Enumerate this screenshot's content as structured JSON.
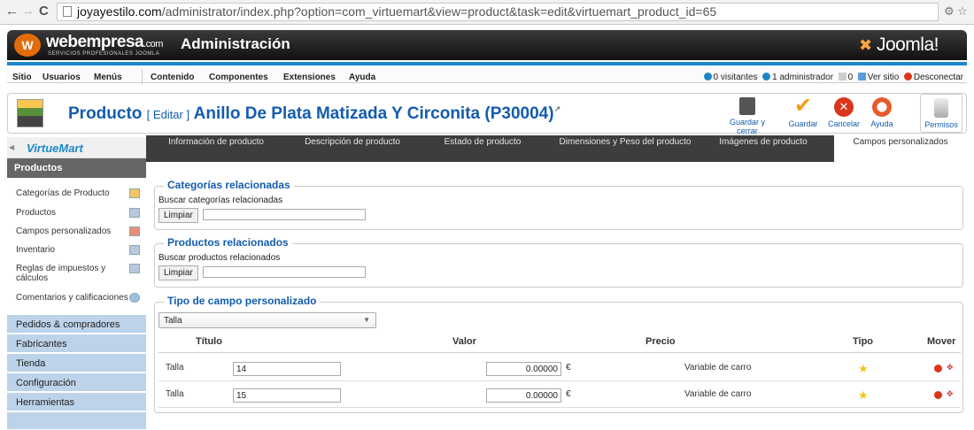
{
  "browser": {
    "url_host": "joyayestilo.com",
    "url_path": "/administrator/index.php?option=com_virtuemart&view=product&task=edit&virtuemart_product_id=65",
    "back": "←",
    "forward": "→",
    "reload": "C"
  },
  "header": {
    "logo_text": "webempresa",
    "logo_suffix": ".com",
    "logo_sub": "SERVICIOS PROFESIONALES JOOMLA",
    "admin_title": "Administración",
    "joomla": "Joomla!"
  },
  "menu": {
    "items": [
      "Sitio",
      "Usuarios",
      "Menús",
      "Contenido",
      "Componentes",
      "Extensiones",
      "Ayuda"
    ],
    "visitors": "0 visitantes",
    "admins": "1 administrador",
    "messages": "0",
    "view_site": "Ver sitio",
    "logout": "Desconectar"
  },
  "toolbar": {
    "title": "Producto",
    "mode": "[ Editar ]",
    "product": "Anillo De Plata Matizada Y Circonita (P30004)",
    "buttons": [
      "Guardar y cerrar",
      "Guardar",
      "Cancelar",
      "Ayuda",
      "Permisos"
    ]
  },
  "sidebar": {
    "brand": "VirtueMart",
    "section": "Productos",
    "items": [
      "Categorías de Producto",
      "Productos",
      "Campos personalizados",
      "Inventario",
      "Reglas de impuestos y cálculos",
      "Comentarios y calificaciones"
    ],
    "categories": [
      "Pedidos & compradores",
      "Fabricantes",
      "Tienda",
      "Configuración",
      "Herramientas"
    ]
  },
  "tabs": [
    "Información de producto",
    "Descripción de producto",
    "Estado de producto",
    "Dimensiones y Peso del producto",
    "Imágenes de producto",
    "Campos personalizados"
  ],
  "related_categories": {
    "legend": "Categorías relacionadas",
    "search_label": "Buscar categorías relacionadas",
    "clear": "Limpiar"
  },
  "related_products": {
    "legend": "Productos relacionados",
    "search_label": "Buscar productos relacionados",
    "clear": "Limpiar"
  },
  "custom_fields": {
    "legend": "Tipo de campo personalizado",
    "select_value": "Talla",
    "headers": [
      "Título",
      "Valor",
      "Precio",
      "Tipo",
      "Mover"
    ],
    "rows": [
      {
        "title": "Talla",
        "value": "14",
        "price": "0.00000",
        "currency": "€",
        "type": "Variable de carro"
      },
      {
        "title": "Talla",
        "value": "15",
        "price": "0.00000",
        "currency": "€",
        "type": "Variable de carro"
      }
    ]
  },
  "colors": {
    "accent_blue": "#135cae",
    "menu_blue": "#1b87c9",
    "sidebar_blue": "#bcd3ea"
  }
}
